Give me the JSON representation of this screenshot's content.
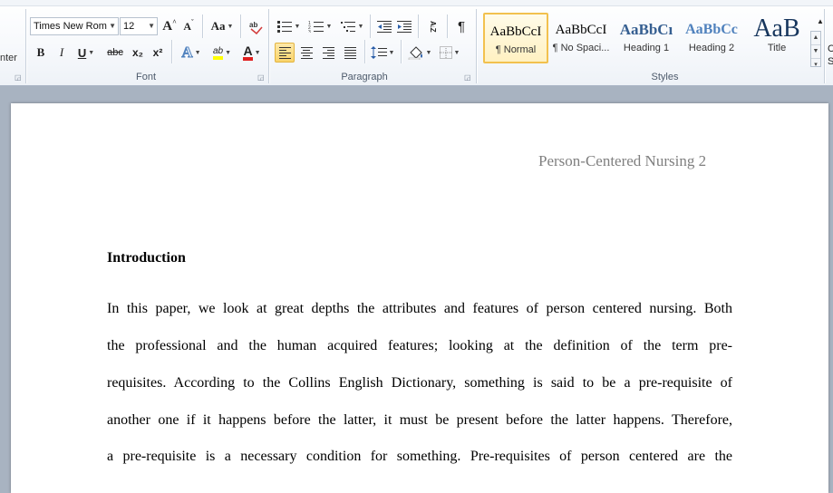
{
  "ribbon": {
    "cut_label": "nter",
    "font": {
      "group_label": "Font",
      "font_name": "Times New Rom",
      "font_size": "12",
      "grow_font": "A",
      "shrink_font": "A",
      "change_case": "Aa",
      "bold": "B",
      "italic": "I",
      "underline": "U",
      "strikethrough": "abc",
      "subscript": "x₂",
      "superscript": "x²",
      "text_effects": "A",
      "highlight": "ab",
      "font_color": "A"
    },
    "paragraph": {
      "group_label": "Paragraph",
      "sort": "A↓Z",
      "show_marks": "¶"
    },
    "styles": {
      "group_label": "Styles",
      "items": [
        {
          "preview": "AaBbCcI",
          "name": "¶ Normal"
        },
        {
          "preview": "AaBbCcI",
          "name": "¶ No Spaci..."
        },
        {
          "preview": "AaBbCı",
          "name": "Heading 1"
        },
        {
          "preview": "AaBbCc",
          "name": "Heading 2"
        },
        {
          "preview": "AaB",
          "name": "Title"
        }
      ],
      "cut_letters": [
        "C",
        "S"
      ]
    }
  },
  "document": {
    "header": "Person-Centered Nursing 2",
    "heading": "Introduction",
    "lines": [
      "In this paper, we look at great depths the attributes and features of person centered nursing. Both",
      "the professional and the human acquired features; looking at the definition of the term pre-",
      "requisites. According to the Collins English Dictionary, something is said to be a pre-requisite of",
      "another one if it happens before the latter, it must be present before the latter happens. Therefore,",
      "a pre-requisite is a necessary condition for something. Pre-requisites of person centered are the"
    ]
  },
  "colors": {
    "highlight_yellow": "#ffff00",
    "font_red": "#e02020",
    "heading_blue": "#365f91",
    "heading2_blue": "#4f81bd",
    "title_blue": "#17365d",
    "selected_gold": "#f2c14e",
    "workspace": "#a8b3c1"
  }
}
